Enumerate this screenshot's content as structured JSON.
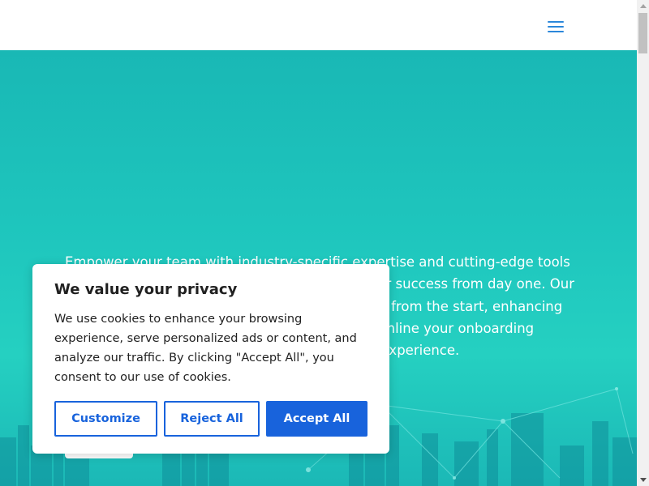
{
  "header": {
    "menu_icon": "hamburger-menu-icon"
  },
  "hero": {
    "text": "Empower your team with industry-specific expertise and cutting-edge tools designed to ensure your new hires are set up for success from day one. Our approach guarantees compliance and efficiency from the start, enhancing engagement and productivity. Let us help streamline your onboarding operations and create an exceptional new hire experience."
  },
  "cookie_banner": {
    "title": "We value your privacy",
    "body": "We use cookies to enhance your browsing experience, serve personalized ads or content, and analyze our traffic. By clicking \"Accept All\", you consent to our use of cookies.",
    "customize_label": "Customize",
    "reject_label": "Reject All",
    "accept_label": "Accept All"
  },
  "colors": {
    "accent": "#1863dc",
    "hero_teal": "#1fc7be",
    "menu_icon": "#2b87da"
  }
}
